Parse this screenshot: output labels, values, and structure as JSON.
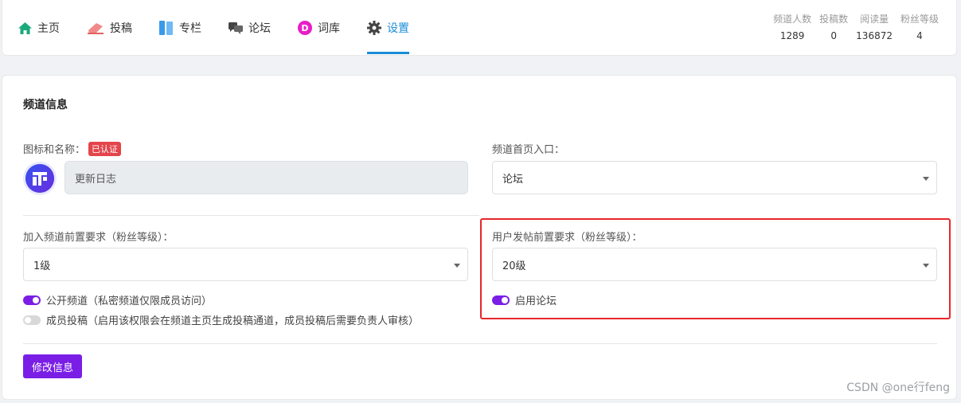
{
  "nav": {
    "items": [
      {
        "label": "主页",
        "icon": "home-icon"
      },
      {
        "label": "投稿",
        "icon": "eraser-icon"
      },
      {
        "label": "专栏",
        "icon": "book-icon"
      },
      {
        "label": "论坛",
        "icon": "chat-icon"
      },
      {
        "label": "词库",
        "icon": "d-badge-icon"
      },
      {
        "label": "设置",
        "icon": "gear-icon",
        "active": true
      }
    ]
  },
  "stats": [
    {
      "label": "频道人数",
      "value": "1289"
    },
    {
      "label": "投稿数",
      "value": "0"
    },
    {
      "label": "阅读量",
      "value": "136872"
    },
    {
      "label": "粉丝等级",
      "value": "4"
    }
  ],
  "card": {
    "title": "频道信息",
    "icon_name_label": "图标和名称：",
    "verified_badge": "已认证",
    "channel_name": "更新日志",
    "entry_label": "频道首页入口：",
    "entry_value": "论坛",
    "join_label": "加入频道前置要求（粉丝等级）：",
    "join_value": "1级",
    "post_label": "用户发帖前置要求（粉丝等级）：",
    "post_value": "20级",
    "public_toggle_label": "公开频道（私密频道仅限成员访问）",
    "member_post_toggle_label": "成员投稿（启用该权限会在频道主页生成投稿通道，成员投稿后需要负责人审核）",
    "forum_toggle_label": "启用论坛",
    "submit_label": "修改信息"
  },
  "watermark": "CSDN @one行feng",
  "colors": {
    "accent": "#7a1ee6",
    "active_tab": "#1a8dd8",
    "badge": "#e3454b",
    "highlight": "#e8262b"
  }
}
